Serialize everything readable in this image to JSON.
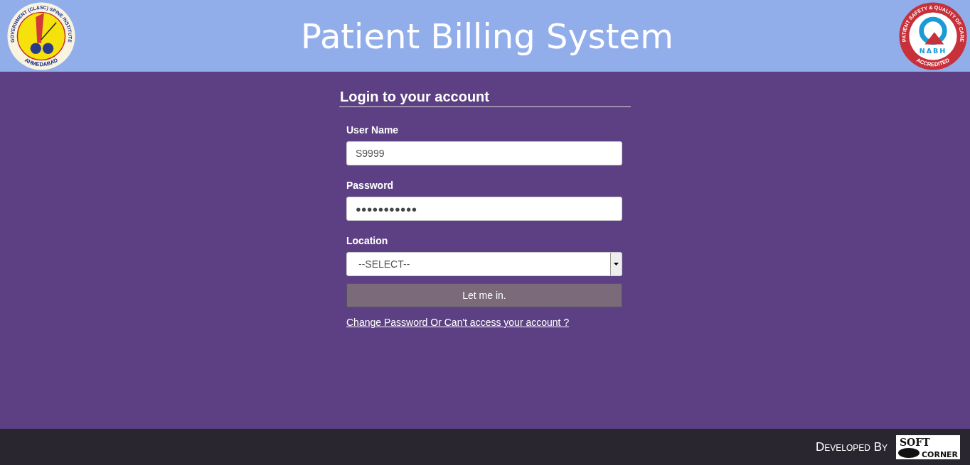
{
  "header": {
    "title": "Patient Billing System",
    "left_logo": {
      "ring_text": "GOVERNMENT (CL&SC) SPINE INSTITUTE",
      "bottom_text": "AHMEDABAD"
    },
    "right_logo": {
      "ring_text": "PATIENT SAFETY & QUALITY OF CARE",
      "center_text": "NABH",
      "bottom_text": "ACCREDITED"
    }
  },
  "login": {
    "heading": "Login to your account",
    "fields": [
      {
        "kind": "text",
        "label": "User Name",
        "value": "S9999"
      },
      {
        "kind": "password",
        "label": "Password",
        "value": "●●●●●●●●●●●"
      },
      {
        "kind": "select",
        "label": "Location",
        "value": "--SELECT--"
      }
    ],
    "submit": "Let me in.",
    "help_link": "Change Password Or Can't access your account ?"
  },
  "footer": {
    "credit": "Developed By",
    "logo_top": "SOFT",
    "logo_bottom": "CORNER"
  }
}
